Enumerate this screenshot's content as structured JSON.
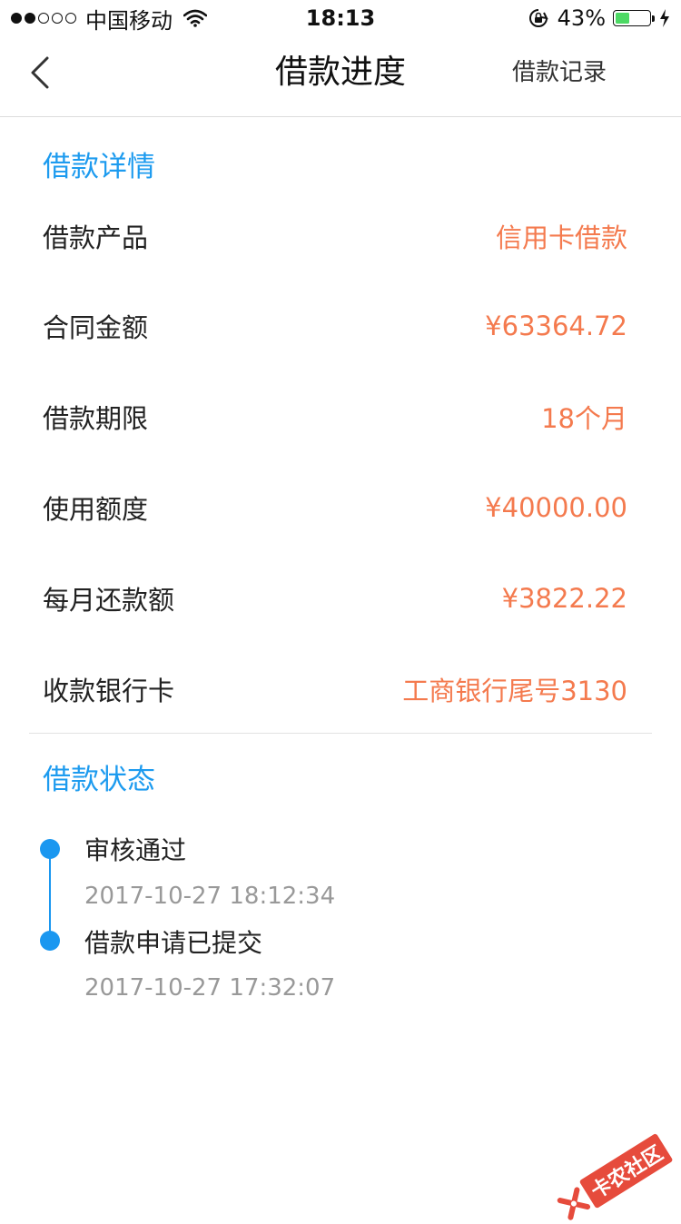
{
  "status_bar": {
    "carrier": "中国移动",
    "time": "18:13",
    "battery": "43%",
    "battery_level": 0.43,
    "signal_filled": 2,
    "signal_total": 5
  },
  "nav": {
    "title": "借款进度",
    "right_label": "借款记录"
  },
  "details": {
    "section_title": "借款详情",
    "rows": [
      {
        "label": "借款产品",
        "value": "信用卡借款"
      },
      {
        "label": "合同金额",
        "value": "¥63364.72"
      },
      {
        "label": "借款期限",
        "value": "18个月"
      },
      {
        "label": "使用额度",
        "value": "¥40000.00"
      },
      {
        "label": "每月还款额",
        "value": "¥3822.22"
      },
      {
        "label": "收款银行卡",
        "value": "工商银行尾号3130"
      }
    ]
  },
  "status": {
    "section_title": "借款状态",
    "events": [
      {
        "title": "审核通过",
        "time": "2017-10-27 18:12:34"
      },
      {
        "title": "借款申请已提交",
        "time": "2017-10-27 17:32:07"
      }
    ]
  },
  "watermark": {
    "text": "卡农社区"
  },
  "colors": {
    "accent": "#1d9bef",
    "value": "#f47a4e",
    "battery": "#4cd964"
  }
}
